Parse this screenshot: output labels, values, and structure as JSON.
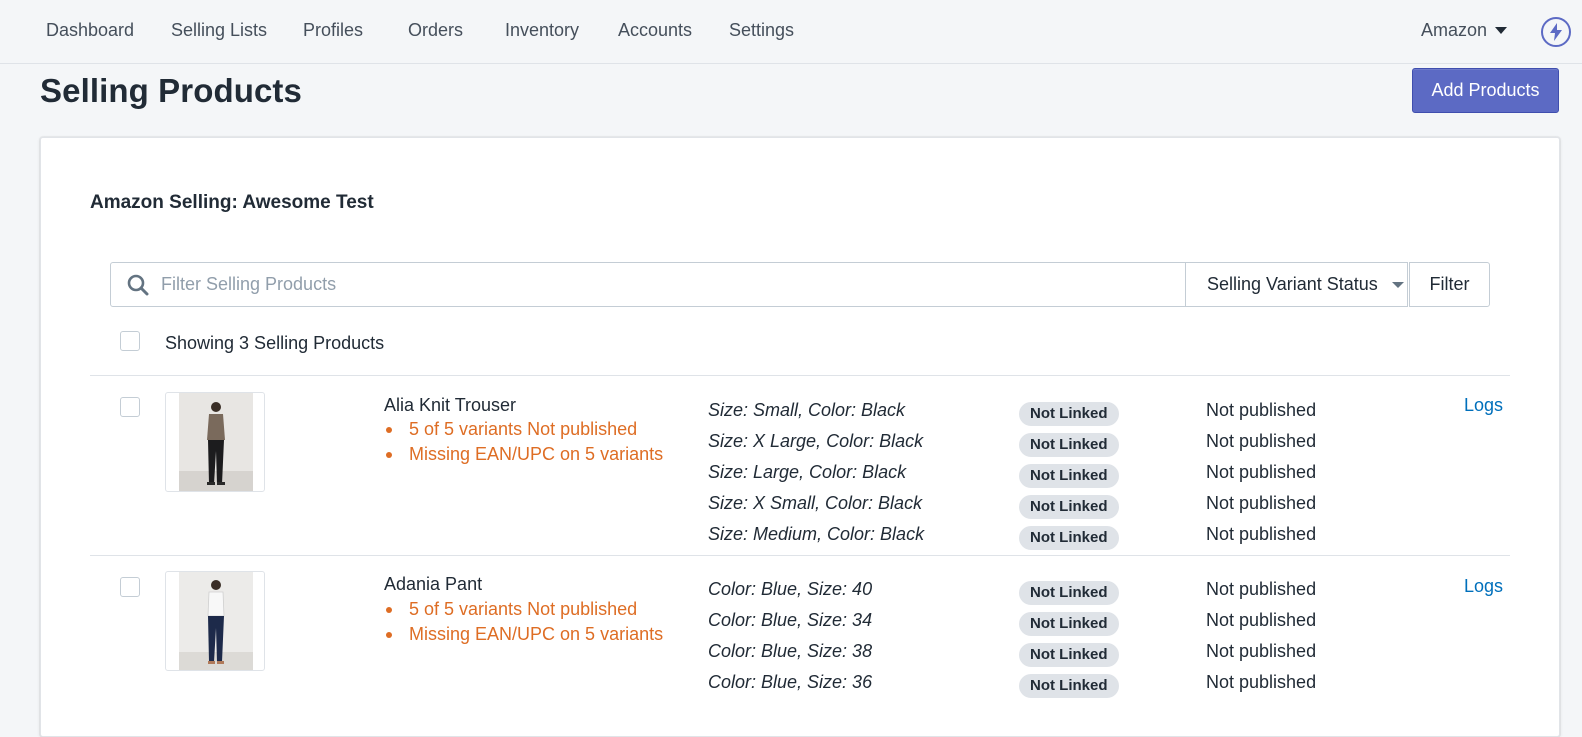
{
  "nav": {
    "items": [
      "Dashboard",
      "Selling Lists",
      "Profiles",
      "Orders",
      "Inventory",
      "Accounts",
      "Settings"
    ],
    "store": "Amazon"
  },
  "page": {
    "title": "Selling Products",
    "add_button": "Add Products"
  },
  "card": {
    "title": "Amazon Selling: Awesome Test",
    "search_placeholder": "Filter Selling Products",
    "status_select": "Selling Variant Status",
    "filter_button": "Filter",
    "showing_text": "Showing 3 Selling Products"
  },
  "products": [
    {
      "name": "Alia Knit Trouser",
      "warnings": [
        "5 of 5 variants Not published",
        "Missing EAN/UPC on 5 variants"
      ],
      "variants": [
        {
          "label": "Size: Small, Color: Black",
          "link_status": "Not Linked",
          "publish_status": "Not published"
        },
        {
          "label": "Size: X Large, Color: Black",
          "link_status": "Not Linked",
          "publish_status": "Not published"
        },
        {
          "label": "Size: Large, Color: Black",
          "link_status": "Not Linked",
          "publish_status": "Not published"
        },
        {
          "label": "Size: X Small, Color: Black",
          "link_status": "Not Linked",
          "publish_status": "Not published"
        },
        {
          "label": "Size: Medium, Color: Black",
          "link_status": "Not Linked",
          "publish_status": "Not published"
        }
      ],
      "logs": "Logs"
    },
    {
      "name": "Adania Pant",
      "warnings": [
        "5 of 5 variants Not published",
        "Missing EAN/UPC on 5 variants"
      ],
      "variants": [
        {
          "label": "Color: Blue, Size: 40",
          "link_status": "Not Linked",
          "publish_status": "Not published"
        },
        {
          "label": "Color: Blue, Size: 34",
          "link_status": "Not Linked",
          "publish_status": "Not published"
        },
        {
          "label": "Color: Blue, Size: 38",
          "link_status": "Not Linked",
          "publish_status": "Not published"
        },
        {
          "label": "Color: Blue, Size: 36",
          "link_status": "Not Linked",
          "publish_status": "Not published"
        }
      ],
      "logs": "Logs"
    }
  ],
  "colors": {
    "accent": "#5c6ac4",
    "warning": "#de6d24",
    "link": "#006fbb"
  }
}
